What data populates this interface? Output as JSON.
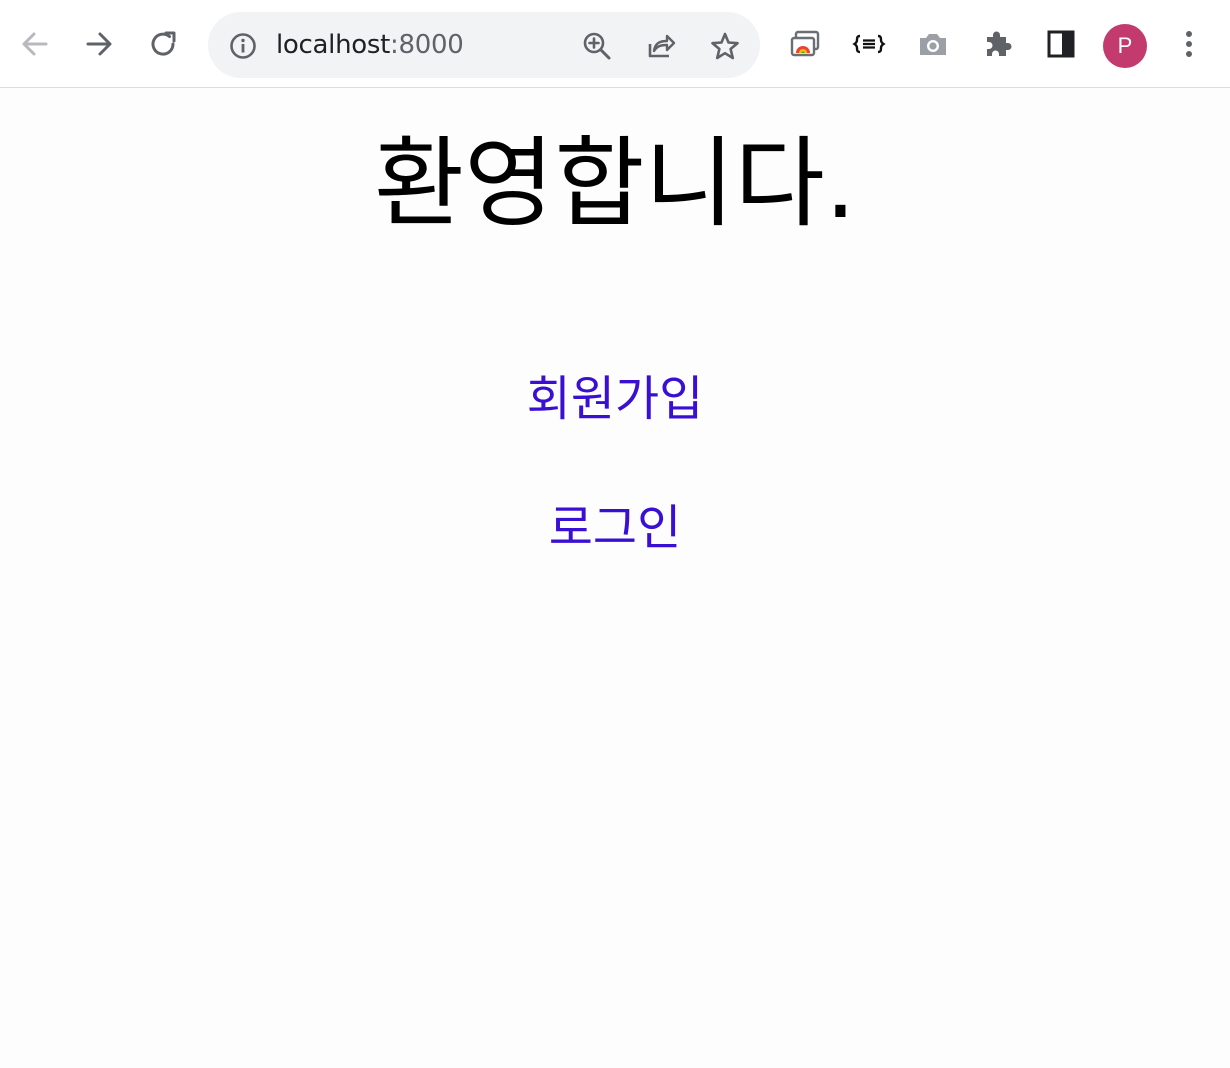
{
  "browser": {
    "url_host": "localhost",
    "url_port": ":8000",
    "profile_initial": "P",
    "icons": {
      "back": "arrow-left-icon",
      "forward": "arrow-right-icon",
      "reload": "reload-icon",
      "site_info": "info-icon",
      "zoom": "zoom-in-icon",
      "share": "share-icon",
      "bookmark": "star-icon",
      "ext1": "cast-window-icon",
      "ext2": "json-formatter-icon",
      "ext3": "camera-icon",
      "extensions": "puzzle-icon",
      "side_panel": "side-panel-icon",
      "menu": "more-vert-icon"
    },
    "colors": {
      "avatar": "#c23a6e",
      "link": "#3a0fd4"
    }
  },
  "page": {
    "title": "환영합니다.",
    "links": {
      "signup": "회원가입",
      "login": "로그인"
    }
  }
}
